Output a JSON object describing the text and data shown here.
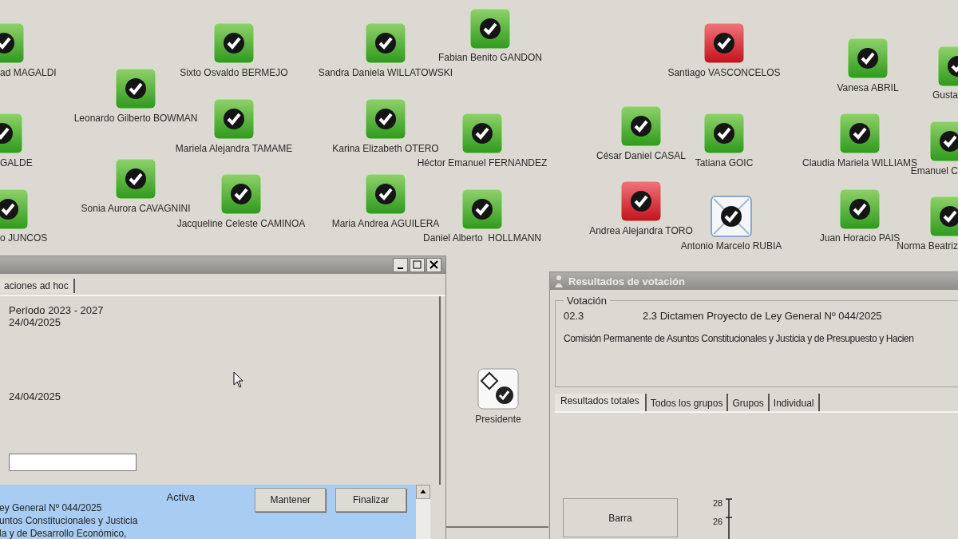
{
  "seats": [
    {
      "name": "ad MAGALDI",
      "kind": "yes"
    },
    {
      "name": "Sixto Osvaldo BERMEJO",
      "kind": "yes"
    },
    {
      "name": "Sandra Daniela WILLATOWSKI",
      "kind": "yes"
    },
    {
      "name": "Fabian Benito GANDON",
      "kind": "yes"
    },
    {
      "name": "Santiago VASCONCELOS",
      "kind": "no"
    },
    {
      "name": "Vanesa ABRIL",
      "kind": "yes"
    },
    {
      "name": "Gusta",
      "kind": "yes"
    },
    {
      "name": "Leonardo Gilberto BOWMAN",
      "kind": "yes"
    },
    {
      "name": "GALDE",
      "kind": "yes"
    },
    {
      "name": "Mariela Alejandra TAMAME",
      "kind": "yes"
    },
    {
      "name": "Karina Elizabeth OTERO",
      "kind": "yes"
    },
    {
      "name": "Héctor Emanuel FERNANDEZ",
      "kind": "yes"
    },
    {
      "name": "César Daniel CASAL",
      "kind": "yes"
    },
    {
      "name": "Tatiana GOIC",
      "kind": "yes"
    },
    {
      "name": "Claudia Mariela WILLIAMS",
      "kind": "yes"
    },
    {
      "name": "Emanuel C",
      "kind": "yes"
    },
    {
      "name": "Sonia Aurora CAVAGNINI",
      "kind": "yes"
    },
    {
      "name": "o JUNCOS",
      "kind": "yes"
    },
    {
      "name": "Jacqueline Celeste CAMINOA",
      "kind": "yes"
    },
    {
      "name": "Maria Andrea AGUILERA",
      "kind": "yes"
    },
    {
      "name": "Daniel Alberto  HOLLMANN",
      "kind": "yes"
    },
    {
      "name": "Andrea Alejandra TORO",
      "kind": "no"
    },
    {
      "name": "Antonio Marcelo RUBIA",
      "kind": "blank"
    },
    {
      "name": "Juan Horacio PAIS",
      "kind": "yes"
    },
    {
      "name": "Norma Beatriz",
      "kind": "yes"
    },
    {
      "name": "Presidente",
      "kind": "president"
    }
  ],
  "session_window": {
    "tabs": [
      {
        "label": "aciones ad hoc",
        "selected": true
      }
    ],
    "period": "Período 2023 - 2027",
    "date_1": "24/04/2025",
    "date_2": "24/04/2025",
    "item": {
      "lines": [
        "ey General Nº 044/2025",
        "untos Constitucionales y Justicia",
        "la y de Desarrollo Económico,"
      ],
      "status": "Activa",
      "buttons": [
        "Mantener",
        "Finalizar"
      ]
    }
  },
  "results_window": {
    "title": "Resultados de votación",
    "group_label": "Votación",
    "code": "02.3",
    "subject": "2.3 Dictamen Proyecto de Ley General Nº 044/2025",
    "committee_line": "Comisión Permanente de Asuntos Constitucionales y Justicia y de Presupuesto y Hacien",
    "tabs": [
      {
        "label": "Resultados totales",
        "selected": true
      },
      {
        "label": "Todos los grupos",
        "selected": false
      },
      {
        "label": "Grupos",
        "selected": false
      },
      {
        "label": "Individual",
        "selected": false
      }
    ],
    "chart_button": "Barra",
    "axis_ticks": [
      "28",
      "26"
    ]
  }
}
